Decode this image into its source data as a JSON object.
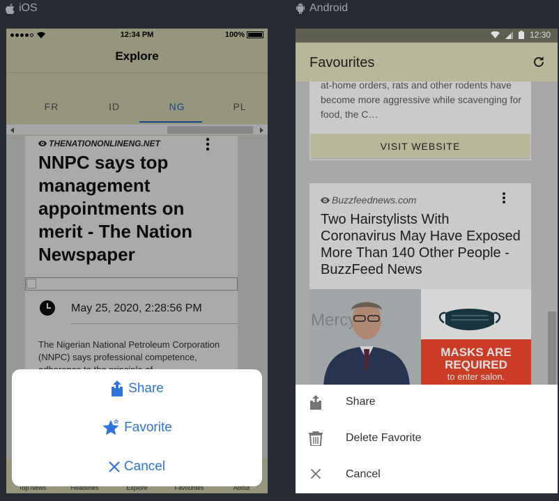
{
  "ios": {
    "platform_label": "iOS",
    "status": {
      "time": "12:34 PM",
      "battery": "100%"
    },
    "title": "Explore",
    "tabs": [
      {
        "label": "FR"
      },
      {
        "label": "ID"
      },
      {
        "label": "NG",
        "active": true
      },
      {
        "label": "PL"
      }
    ],
    "article": {
      "source": "THENATIONONLINENG.NET",
      "headline": "NNPC says top management appointments on merit - The Nation Newspaper",
      "date": "May 25, 2020, 2:28:56 PM",
      "description": "The Nigerian National Petroleum Corporation (NNPC) says professional competence, adherence to the principle of"
    },
    "bottom_tabs": [
      "Top News",
      "Headlines",
      "Explore",
      "Favourites",
      "About"
    ],
    "action_sheet": [
      {
        "label": "Share",
        "icon": "share-icon"
      },
      {
        "label": "Favorite",
        "icon": "star-icon"
      },
      {
        "label": "Cancel",
        "icon": "close-icon"
      }
    ],
    "accent_color": "#2f73d9"
  },
  "android": {
    "platform_label": "Android",
    "status": {
      "time": "12:30"
    },
    "title": "Favourites",
    "card1": {
      "text": "at-home orders, rats and other rodents have become more aggressive while scavenging for food, the C…",
      "button": "VISIT WEBSITE"
    },
    "card2": {
      "source": "Buzzfeednews.com",
      "headline": "Two Hairstylists With Coronavirus May Have Exposed More Than 140 Other People - BuzzFeed News",
      "image_sign": [
        "MASKS ARE",
        "REQUIRED",
        "to enter salon."
      ],
      "image_backdrop_text": "Mercy"
    },
    "bottom_sheet": [
      {
        "label": "Share",
        "icon": "share-icon"
      },
      {
        "label": "Delete Favorite",
        "icon": "trash-icon"
      },
      {
        "label": "Cancel",
        "icon": "close-icon"
      }
    ],
    "toolbar_color": "#d2d2ad"
  }
}
